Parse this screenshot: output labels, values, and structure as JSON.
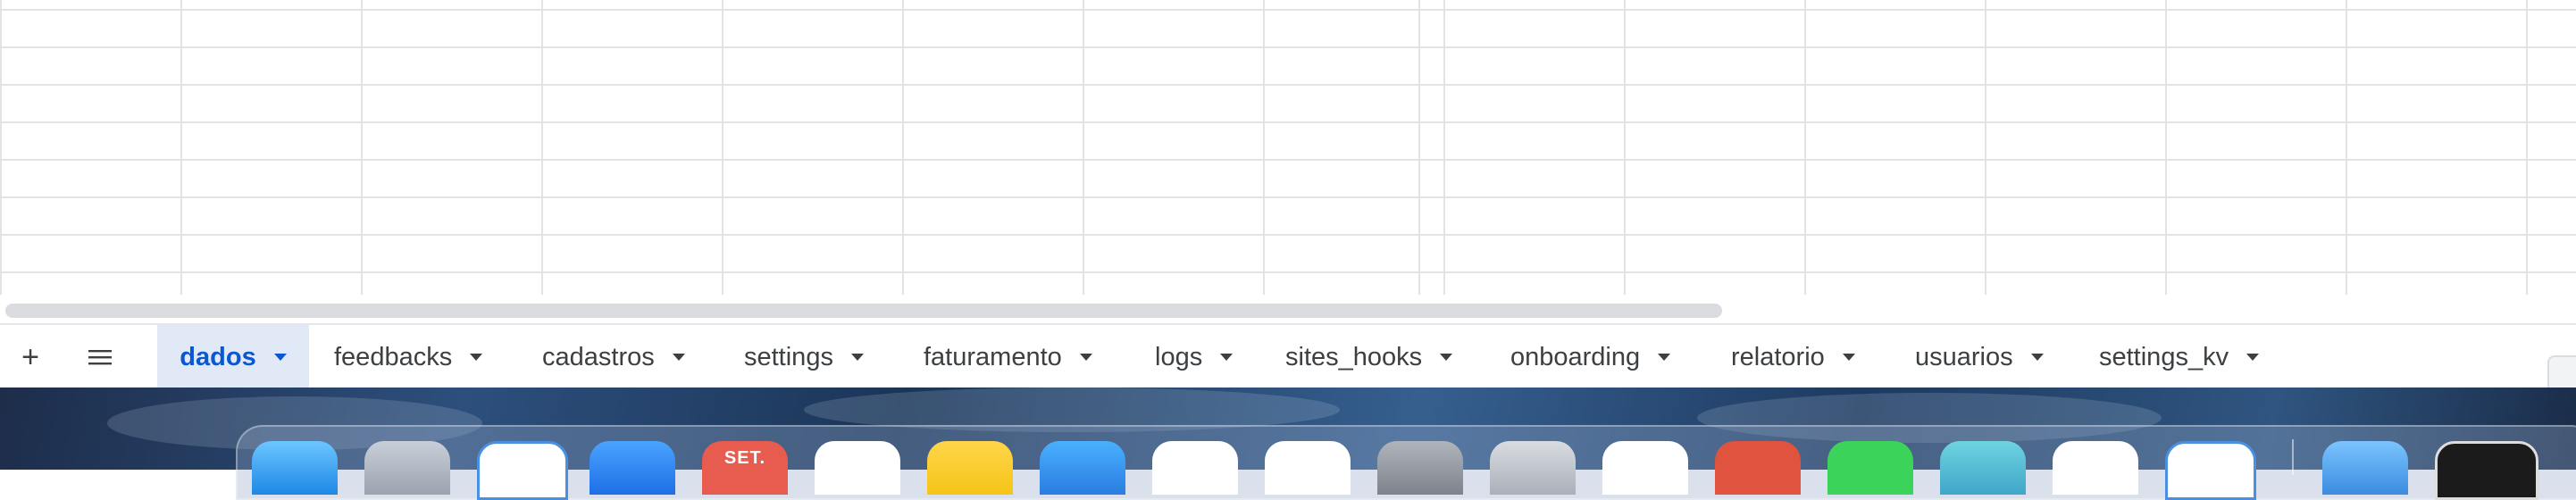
{
  "sheet_tabs": [
    {
      "label": "dados",
      "active": true
    },
    {
      "label": "feedbacks",
      "active": false
    },
    {
      "label": "cadastros",
      "active": false
    },
    {
      "label": "settings",
      "active": false
    },
    {
      "label": "faturamento",
      "active": false
    },
    {
      "label": "logs",
      "active": false
    },
    {
      "label": "sites_hooks",
      "active": false
    },
    {
      "label": "onboarding",
      "active": false
    },
    {
      "label": "relatorio",
      "active": false
    },
    {
      "label": "usuarios",
      "active": false
    },
    {
      "label": "settings_kv",
      "active": false
    }
  ],
  "toolbar": {
    "add_sheet_label": "+",
    "add_sheet_icon": "plus-icon",
    "all_sheets_icon": "hamburger-menu-icon"
  },
  "dock": {
    "calendar_badge": "SET.",
    "apps": [
      "finder-icon",
      "launchpad-icon",
      "safari-icon",
      "mail-icon",
      "calendar-icon",
      "reminders-icon",
      "notes-icon",
      "tasks-app-icon",
      "keynote-icon",
      "numbers-icon",
      "system-settings-icon",
      "iphone-mirroring-icon",
      "terminal-icon",
      "chrome-icon",
      "whatsapp-icon",
      "app-icon",
      "word-icon",
      "safari-alt-icon",
      "folder-icon",
      "screenshot-icon"
    ]
  },
  "colors": {
    "active_tab_bg": "#e1e9f7",
    "active_tab_text": "#0b57d0",
    "tab_text": "#3c4043",
    "grid_line": "#e2e3e3"
  }
}
